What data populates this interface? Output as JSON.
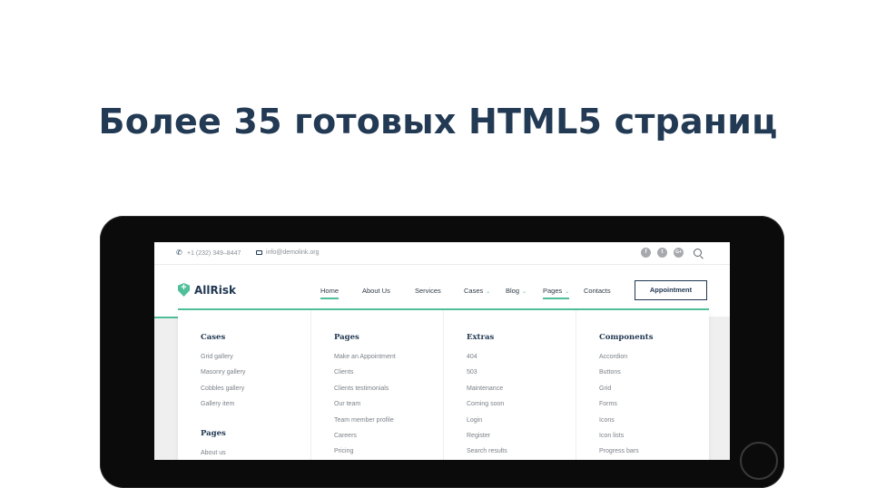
{
  "headline": "Более 35 готовых HTML5 страниц",
  "site": {
    "topbar": {
      "phone": "+1 (232) 349–8447",
      "email": "info@demolink.org",
      "social_icons": [
        "facebook-icon",
        "twitter-icon",
        "google-plus-icon"
      ],
      "social_glyphs": [
        "f",
        "t",
        "G+"
      ]
    },
    "logo": "AllRisk",
    "nav": {
      "home": "Home",
      "about": "About Us",
      "services": "Services",
      "cases": "Cases",
      "blog": "Blog",
      "pages": "Pages",
      "contacts": "Contacts",
      "appointment": "Appointment"
    },
    "mega": {
      "cases": {
        "title": "Cases",
        "items": [
          "Grid gallery",
          "Masonry gallery",
          "Cobbles gallery",
          "Gallery item"
        ],
        "pages_title": "Pages",
        "pages_items": [
          "About us"
        ]
      },
      "pages": {
        "title": "Pages",
        "items": [
          "Make an Appointment",
          "Clients",
          "Clients testimonials",
          "Our team",
          "Team member profile",
          "Careers",
          "Pricing"
        ]
      },
      "extras": {
        "title": "Extras",
        "items": [
          "404",
          "503",
          "Maintenance",
          "Coming soon",
          "Login",
          "Register",
          "Search results"
        ]
      },
      "components": {
        "title": "Components",
        "items": [
          "Accordion",
          "Buttons",
          "Grid",
          "Forms",
          "Icons",
          "Icon lists",
          "Progress bars"
        ]
      }
    }
  },
  "colors": {
    "accent": "#4fbf9a",
    "navy": "#1f3650",
    "headline": "#233a54"
  }
}
